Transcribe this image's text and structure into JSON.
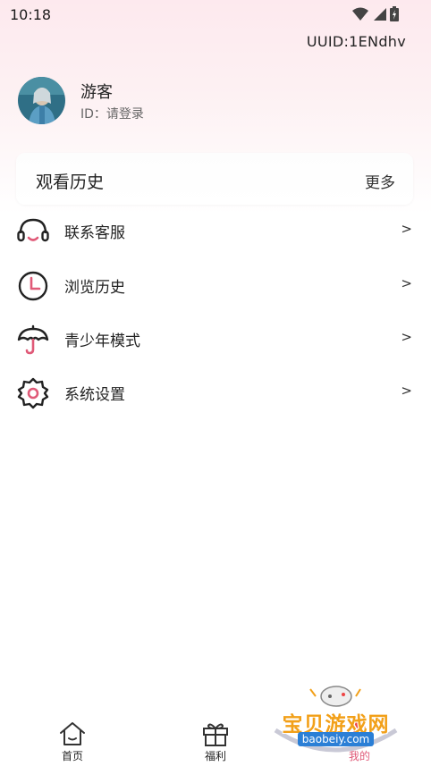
{
  "status_bar": {
    "time": "10:18"
  },
  "profile": {
    "uuid": "UUID:1ENdhv",
    "username": "游客",
    "id_label": "ID：",
    "id_value": "请登录"
  },
  "history": {
    "title": "观看历史",
    "more": "更多"
  },
  "menu": [
    {
      "label": "联系客服",
      "icon": "headset-icon",
      "arrow": ">"
    },
    {
      "label": "浏览历史",
      "icon": "clock-icon",
      "arrow": ">"
    },
    {
      "label": "青少年模式",
      "icon": "umbrella-icon",
      "arrow": ">"
    },
    {
      "label": "系统设置",
      "icon": "gear-icon",
      "arrow": ">"
    }
  ],
  "bottom_nav": [
    {
      "label": "首页",
      "icon": "home-icon"
    },
    {
      "label": "福利",
      "icon": "gift-icon"
    },
    {
      "label": "我的",
      "icon": "user-icon"
    }
  ],
  "watermark": {
    "title": "宝贝游戏网",
    "url": "baobeiy.com"
  },
  "colors": {
    "accent": "#e05a78",
    "text": "#222222",
    "background_top": "#fde9ee"
  }
}
